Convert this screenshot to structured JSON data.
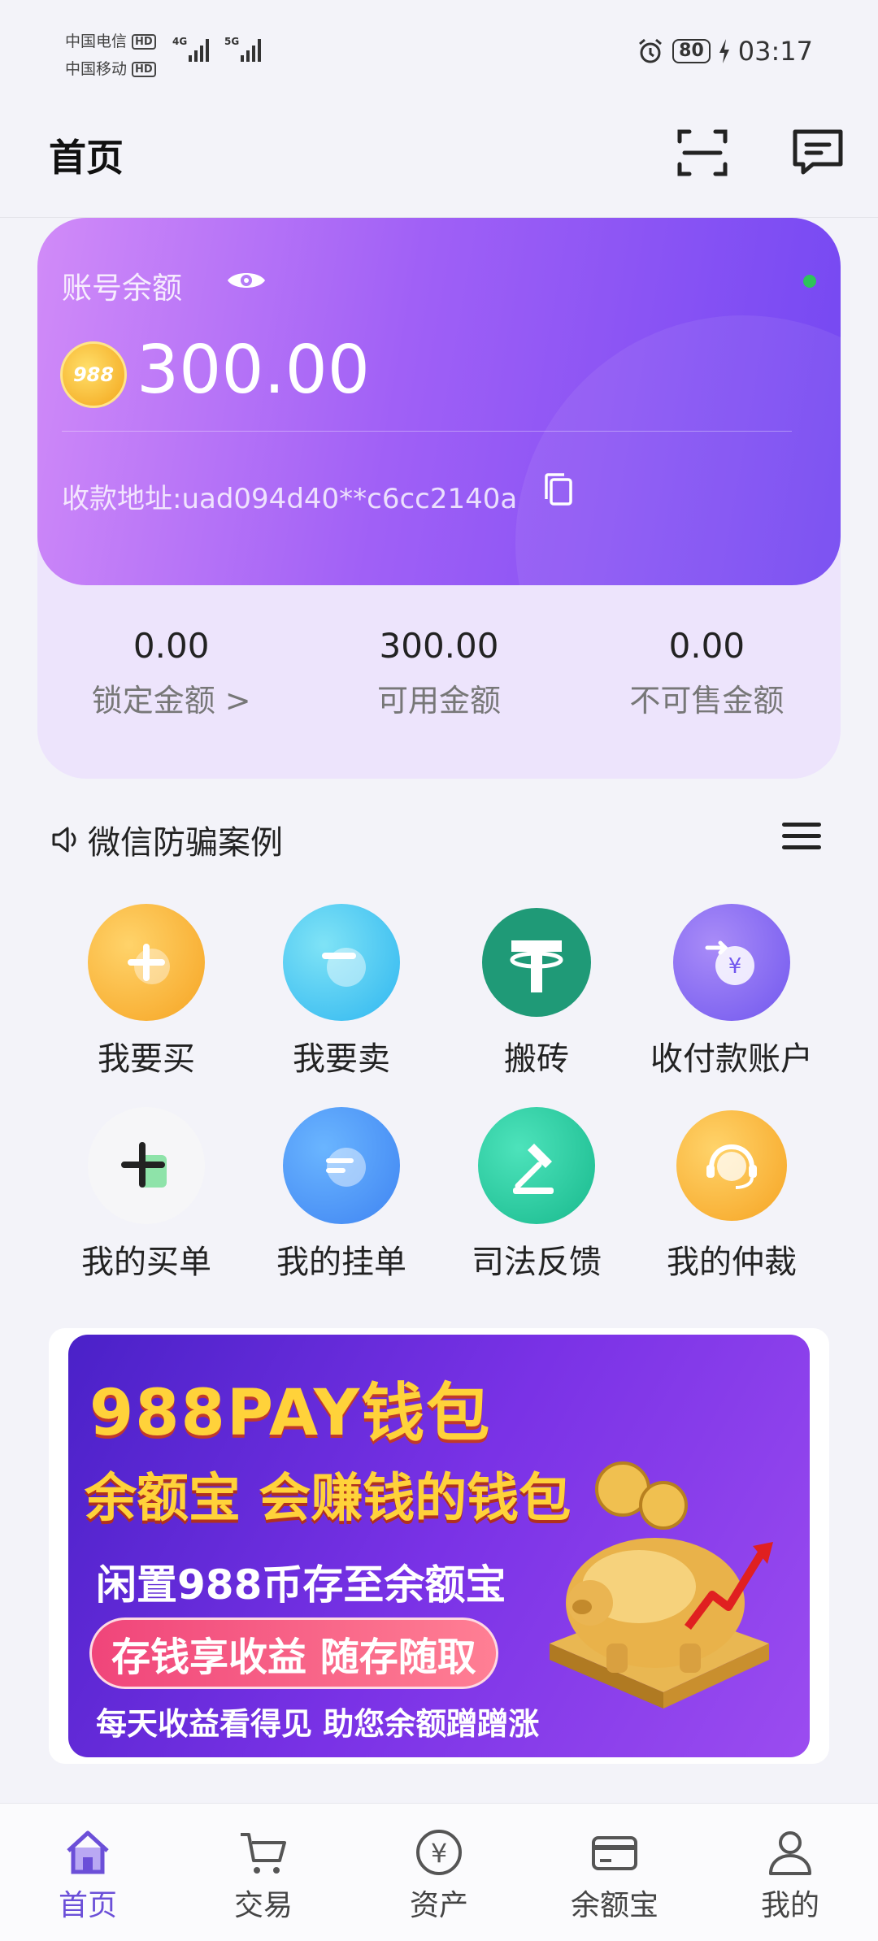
{
  "status_bar": {
    "carrier1": "中国电信",
    "carrier2": "中国移动",
    "hd": "HD",
    "net1": "4G",
    "net2": "5G",
    "battery": "80",
    "time": "03:17"
  },
  "header": {
    "title": "首页",
    "scan_icon": "scan-icon",
    "message_icon": "message-icon"
  },
  "balance_card": {
    "label": "账号余额",
    "coin_label": "988",
    "amount": "300.00",
    "address": "收款地址:uad094d40**c6cc2140a"
  },
  "stats": [
    {
      "value": "0.00",
      "label": "锁定金额 >"
    },
    {
      "value": "300.00",
      "label": "可用金额"
    },
    {
      "value": "0.00",
      "label": "不可售金额"
    }
  ],
  "notice": {
    "text": "微信防骗案例"
  },
  "actions_row1": [
    {
      "label": "我要买",
      "icon": "plus-circle-icon"
    },
    {
      "label": "我要卖",
      "icon": "minus-circle-icon"
    },
    {
      "label": "搬砖",
      "icon": "tether-icon"
    },
    {
      "label": "收付款账户",
      "icon": "exchange-yen-icon"
    }
  ],
  "actions_row2": [
    {
      "label": "我的买单",
      "icon": "plus-note-icon"
    },
    {
      "label": "我的挂单",
      "icon": "list-icon"
    },
    {
      "label": "司法反馈",
      "icon": "gavel-icon"
    },
    {
      "label": "我的仲裁",
      "icon": "headset-icon"
    }
  ],
  "banner": {
    "title": "988PAY钱包",
    "subtitle": "余额宝 会赚钱的钱包",
    "line1": "闲置988币存至余额宝",
    "pill": "存钱享收益 随存随取",
    "line2": "每天收益看得见 助您余额蹭蹭涨"
  },
  "tabbar": [
    {
      "label": "首页",
      "icon": "home-icon",
      "active": true
    },
    {
      "label": "交易",
      "icon": "cart-icon",
      "active": false
    },
    {
      "label": "资产",
      "icon": "yen-icon",
      "active": false
    },
    {
      "label": "余额宝",
      "icon": "card-icon",
      "active": false
    },
    {
      "label": "我的",
      "icon": "user-icon",
      "active": false
    }
  ],
  "colors": {
    "accent": "#6b4fd8",
    "card_start": "#d18bf8",
    "card_end": "#7347f2"
  }
}
